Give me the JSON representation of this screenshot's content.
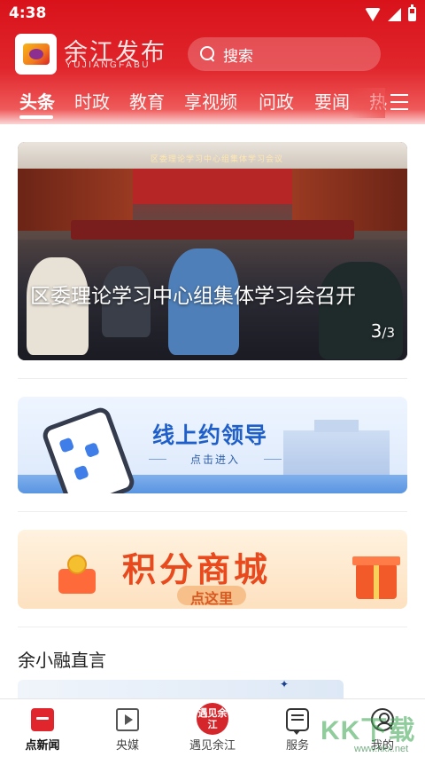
{
  "status_bar": {
    "time": "4:38"
  },
  "header": {
    "brand_name": "余江发布",
    "brand_pinyin": "YUJIANGFABU",
    "search_placeholder": "搜索",
    "tabs": [
      {
        "label": "头条",
        "active": true
      },
      {
        "label": "时政",
        "active": false
      },
      {
        "label": "教育",
        "active": false
      },
      {
        "label": "享视频",
        "active": false
      },
      {
        "label": "问政",
        "active": false
      },
      {
        "label": "要闻",
        "active": false
      },
      {
        "label": "热",
        "active": false
      }
    ]
  },
  "hero": {
    "title": "区委理论学习中心组集体学习会召开",
    "wall_banner": "区委理论学习中心组集体学习会议",
    "counter_current": "3",
    "counter_total": "/3"
  },
  "banners": {
    "online": {
      "title": "线上约领导",
      "subtitle": "点击进入"
    },
    "mall": {
      "title": "积分商城",
      "subtitle": "点这里"
    }
  },
  "section": {
    "title": "余小融直言"
  },
  "bottom_nav": [
    {
      "label": "点新闻",
      "icon": "news-icon",
      "active": true
    },
    {
      "label": "央媒",
      "icon": "video-icon",
      "active": false
    },
    {
      "label": "遇见余江",
      "icon": "meet-yujiang-icon",
      "icon_text": "遇见余江",
      "active": false
    },
    {
      "label": "服务",
      "icon": "service-chat-icon",
      "active": false
    },
    {
      "label": "我的",
      "icon": "profile-icon",
      "active": false
    }
  ],
  "watermark": {
    "text": "KK下载",
    "url": "www.kkx.net"
  },
  "colors": {
    "brand_red": "#d9121a",
    "accent_blue": "#1f5fc9",
    "mall_orange": "#e84a1e"
  }
}
